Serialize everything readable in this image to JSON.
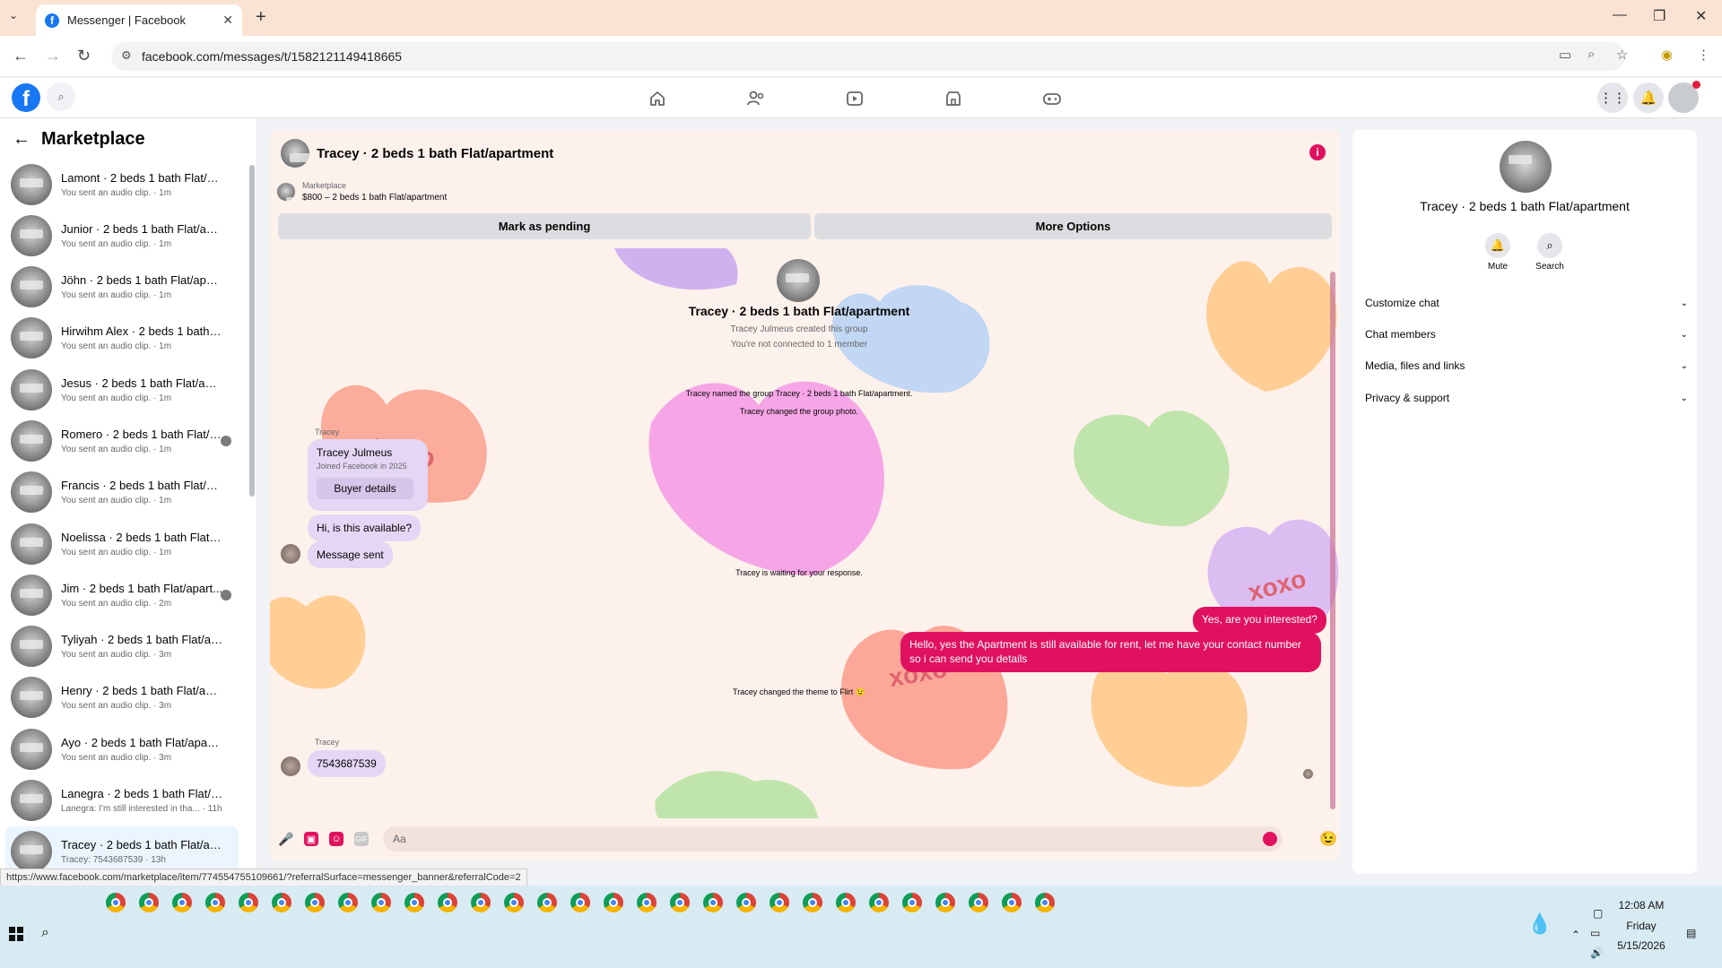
{
  "browser": {
    "tab_title": "Messenger | Facebook",
    "url": "facebook.com/messages/t/1582121149418665",
    "status_url": "https://www.facebook.com/marketplace/item/774554755109661/?referralSurface=messenger_banner&referralCode=2"
  },
  "sidebar": {
    "title": "Marketplace",
    "conversations": [
      {
        "name": "Lamont · 2 beds 1 bath Flat/apa...",
        "preview": "You sent an audio clip. · 1m"
      },
      {
        "name": "Junior · 2 beds 1 bath Flat/apart...",
        "preview": "You sent an audio clip. · 1m"
      },
      {
        "name": "Jöhn · 2 beds 1 bath Flat/apart...",
        "preview": "You sent an audio clip. · 1m"
      },
      {
        "name": "Hirwihm Alex · 2 beds 1 bath Fl...",
        "preview": "You sent an audio clip. · 1m"
      },
      {
        "name": "Jesus · 2 beds 1 bath Flat/apart...",
        "preview": "You sent an audio clip. · 1m"
      },
      {
        "name": "Romero · 2 beds 1 bath Flat/a...",
        "preview": "You sent an audio clip. · 1m"
      },
      {
        "name": "Francis · 2 beds 1 bath Flat/apar...",
        "preview": "You sent an audio clip. · 1m"
      },
      {
        "name": "Noelissa · 2 beds 1 bath Flat/ap...",
        "preview": "You sent an audio clip. · 1m"
      },
      {
        "name": "Jim · 2 beds 1 bath Flat/apart...",
        "preview": "You sent an audio clip. · 2m"
      },
      {
        "name": "Tyliyah · 2 beds 1 bath Flat/apar...",
        "preview": "You sent an audio clip. · 3m"
      },
      {
        "name": "Henry · 2 beds 1 bath Flat/apart...",
        "preview": "You sent an audio clip. · 3m"
      },
      {
        "name": "Ayo · 2 beds 1 bath Flat/apartm...",
        "preview": "You sent an audio clip. · 3m"
      },
      {
        "name": "Lanegra · 2 beds 1 bath Flat/apa...",
        "preview": "Lanegra: I'm still interested in tha... · 11h"
      },
      {
        "name": "Tracey · 2 beds 1 bath Flat/apart...",
        "preview": "Tracey: 7543687539 · 13h"
      }
    ]
  },
  "chat": {
    "title": "Tracey · 2 beds 1 bath Flat/apartment",
    "marketplace_label": "Marketplace",
    "listing": "$800 – 2 beds 1 bath Flat/apartment",
    "mark_pending": "Mark as pending",
    "more_options": "More Options",
    "group_title": "Tracey · 2 beds 1 bath Flat/apartment",
    "created": "Tracey Julmeus created this group",
    "not_connected": "You're not connected to 1 member",
    "named_group": "Tracey named the group Tracey · 2 beds 1 bath Flat/apartment.",
    "changed_photo": "Tracey changed the group photo.",
    "sender1": "Tracey",
    "buyer_name": "Tracey Julmeus",
    "buyer_joined": "Joined Facebook in 2025",
    "buyer_details": "Buyer details",
    "msg_available": "Hi, is this available?",
    "msg_sent": "Message sent",
    "waiting": "Tracey is waiting for your response.",
    "out1": "Yes, are you interested?",
    "out2_line1": "Hello, yes the Apartment is still available for rent, let me have your contact number",
    "out2_line2": "so i can send you details",
    "theme_change": "Tracey changed the theme to Flirt 😉",
    "sender2": "Tracey",
    "phone_msg": "7543687539",
    "input_placeholder": "Aa",
    "heart_text": "xoxo"
  },
  "right_panel": {
    "title": "Tracey · 2 beds 1 bath Flat/apartment",
    "mute": "Mute",
    "search": "Search",
    "sections": [
      "Customize chat",
      "Chat members",
      "Media, files and links",
      "Privacy & support"
    ]
  },
  "taskbar": {
    "time": "12:08 AM",
    "day": "Friday",
    "date": "5/15/2026"
  },
  "colors": {
    "accent": "#e0115f",
    "facebook_blue": "#1877f2",
    "chat_bg": "#fdf1ec"
  }
}
